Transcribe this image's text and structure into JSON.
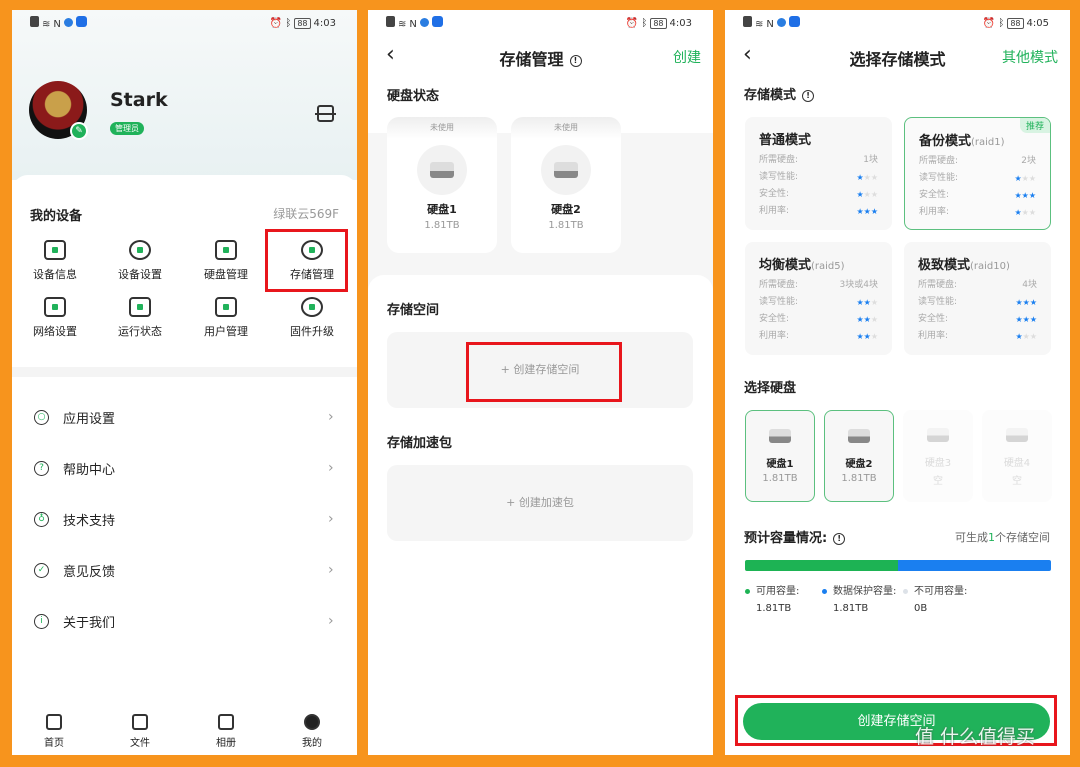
{
  "colors": {
    "accent": "#20b25a",
    "blue": "#1a7ff0",
    "frame": "#F7941D",
    "highlight": "#e8161c"
  },
  "screens": [
    {
      "status": {
        "time": "4:03",
        "battery": "88"
      }
    },
    {
      "status": {
        "time": "4:03",
        "battery": "88"
      }
    },
    {
      "status": {
        "time": "4:05",
        "battery": "88"
      }
    }
  ],
  "profile": {
    "name": "Stark",
    "role_badge": "管理员"
  },
  "devices": {
    "title": "我的设备",
    "device_name": "绿联云569F",
    "items": [
      {
        "label": "设备信息",
        "icon": "monitor-chart-icon"
      },
      {
        "label": "设备设置",
        "icon": "gear-icon"
      },
      {
        "label": "硬盘管理",
        "icon": "drives-icon"
      },
      {
        "label": "存储管理",
        "icon": "pie-chart-icon",
        "highlighted": true
      },
      {
        "label": "网络设置",
        "icon": "signal-bars-icon"
      },
      {
        "label": "运行状态",
        "icon": "monitor-trend-icon"
      },
      {
        "label": "用户管理",
        "icon": "user-list-icon"
      },
      {
        "label": "固件升级",
        "icon": "upgrade-arrow-icon"
      }
    ]
  },
  "menu": [
    {
      "label": "应用设置",
      "icon": "hexagon-icon",
      "glyph": "○"
    },
    {
      "label": "帮助中心",
      "icon": "question-icon",
      "glyph": "?"
    },
    {
      "label": "技术支持",
      "icon": "support-icon",
      "glyph": "♁"
    },
    {
      "label": "意见反馈",
      "icon": "feedback-icon",
      "glyph": "✓"
    },
    {
      "label": "关于我们",
      "icon": "info-icon",
      "glyph": "i"
    }
  ],
  "bottom_nav": [
    {
      "label": "首页",
      "icon": "home-icon"
    },
    {
      "label": "文件",
      "icon": "folder-icon"
    },
    {
      "label": "相册",
      "icon": "photo-icon"
    },
    {
      "label": "我的",
      "icon": "profile-icon",
      "active": true
    }
  ],
  "storage": {
    "title": "存储管理",
    "create": "创建",
    "disk_status_title": "硬盘状态",
    "disks": [
      {
        "tag": "未使用",
        "name": "硬盘1",
        "size": "1.81TB"
      },
      {
        "tag": "未使用",
        "name": "硬盘2",
        "size": "1.81TB"
      }
    ],
    "space_title": "存储空间",
    "create_space": "+ 创建存储空间",
    "accel_title": "存储加速包",
    "create_accel": "+ 创建加速包"
  },
  "mode_select": {
    "title": "选择存储模式",
    "other_modes": "其他模式",
    "section_title": "存储模式",
    "row_labels": [
      "所需硬盘:",
      "读写性能:",
      "安全性:",
      "利用率:"
    ],
    "modes": [
      {
        "name": "普通模式",
        "raid": "",
        "disks": "1块",
        "perf": 1,
        "safety": 1,
        "usage": 3
      },
      {
        "name": "备份模式",
        "raid": "(raid1)",
        "disks": "2块",
        "perf": 1,
        "safety": 3,
        "usage": 1,
        "selected": true,
        "badge": "推荐"
      },
      {
        "name": "均衡模式",
        "raid": "(raid5)",
        "disks": "3块或4块",
        "perf": 2,
        "safety": 2,
        "usage": 2
      },
      {
        "name": "极致模式",
        "raid": "(raid10)",
        "disks": "4块",
        "perf": 3,
        "safety": 3,
        "usage": 1
      }
    ],
    "disk_title": "选择硬盘",
    "disks": [
      {
        "name": "硬盘1",
        "size": "1.81TB",
        "selected": true
      },
      {
        "name": "硬盘2",
        "size": "1.81TB",
        "selected": true
      },
      {
        "name": "硬盘3",
        "size": "空",
        "empty": true
      },
      {
        "name": "硬盘4",
        "size": "空",
        "empty": true
      }
    ],
    "capacity_title": "预计容量情况:",
    "capacity_note_pre": "可生成",
    "capacity_note_count": "1",
    "capacity_note_post": "个存储空间",
    "capacity": [
      {
        "label": "可用容量:",
        "value": "1.81TB",
        "color": "#1db354",
        "share": 0.5
      },
      {
        "label": "数据保护容量:",
        "value": "1.81TB",
        "color": "#1a7ff0",
        "share": 0.5
      },
      {
        "label": "不可用容量:",
        "value": "0B",
        "color": "#dde2e8",
        "share": 0
      }
    ],
    "create_button": "创建存储空间",
    "watermark": "值 什么值得买"
  }
}
